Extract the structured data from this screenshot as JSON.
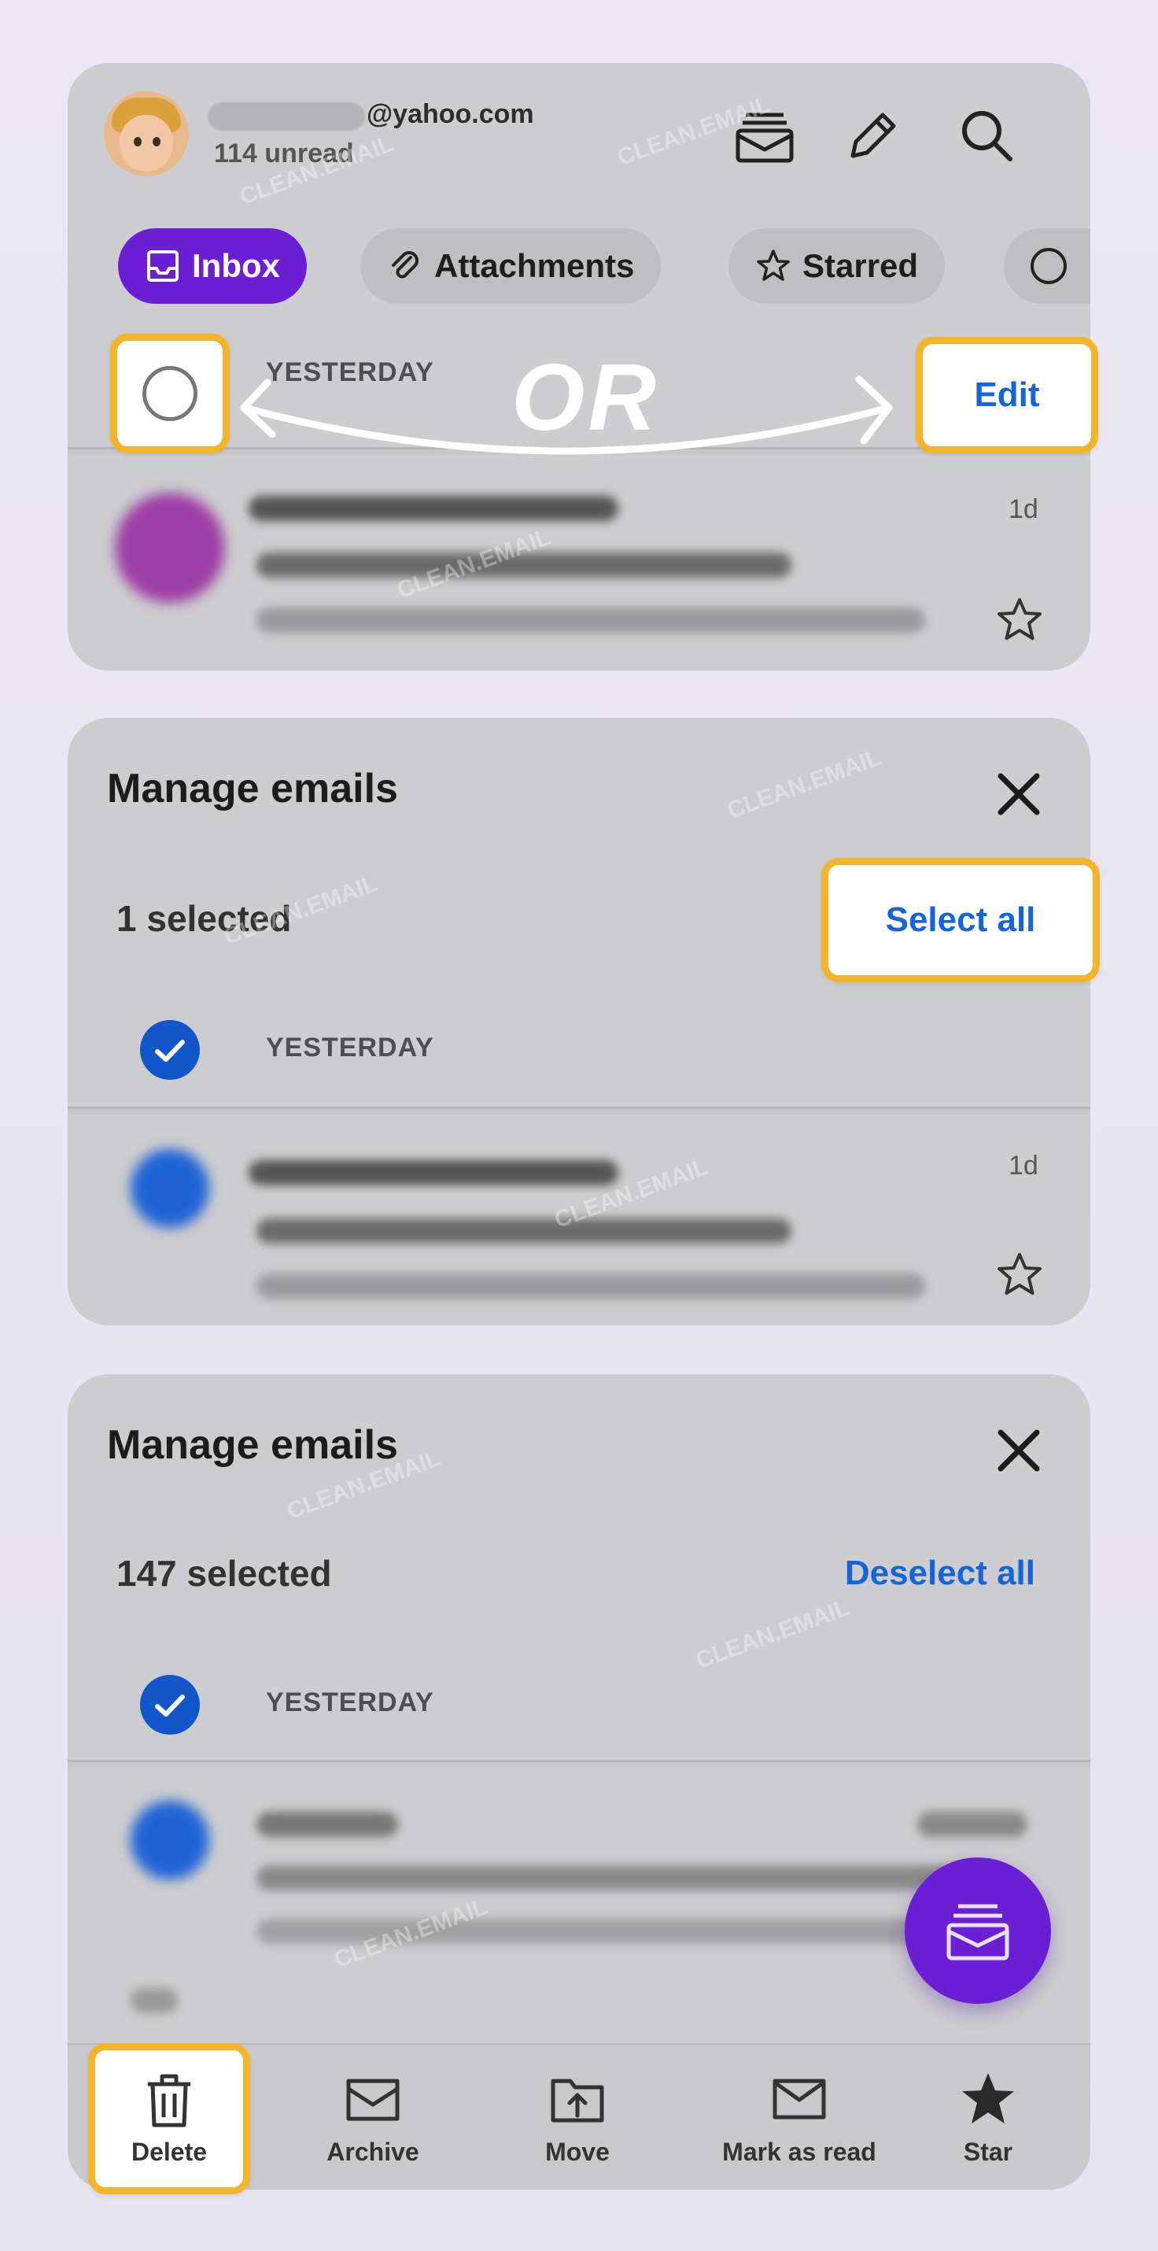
{
  "header": {
    "email_domain": "@yahoo.com",
    "unread": "114 unread"
  },
  "icons": {
    "views": "stacked-mail-icon",
    "compose": "pencil-icon",
    "search": "search-icon"
  },
  "chips": [
    {
      "label": "Inbox",
      "icon": "inbox-icon",
      "active": true
    },
    {
      "label": "Attachments",
      "icon": "paperclip-icon",
      "active": false
    },
    {
      "label": "Starred",
      "icon": "star-icon",
      "active": false
    }
  ],
  "list": {
    "day_label": "YESTERDAY",
    "time_ago": "1d"
  },
  "annotations": {
    "or": "OR",
    "edit": "Edit",
    "select_all": "Select all"
  },
  "manage1": {
    "title": "Manage emails",
    "selected": "1 selected"
  },
  "manage2": {
    "title": "Manage emails",
    "selected": "147 selected",
    "deselect": "Deselect all"
  },
  "bottom_bar": [
    {
      "label": "Delete",
      "icon": "trash-icon"
    },
    {
      "label": "Archive",
      "icon": "archive-icon"
    },
    {
      "label": "Move",
      "icon": "move-icon"
    },
    {
      "label": "Mark as read",
      "icon": "envelope-icon"
    },
    {
      "label": "Star",
      "icon": "star-filled-icon"
    }
  ],
  "watermark": "CLEAN.EMAIL",
  "colors": {
    "brand_purple": "#6a1fd4",
    "link_blue": "#1565d8",
    "highlight": "#f5b52b",
    "card_gray": "#cdcdcf"
  }
}
